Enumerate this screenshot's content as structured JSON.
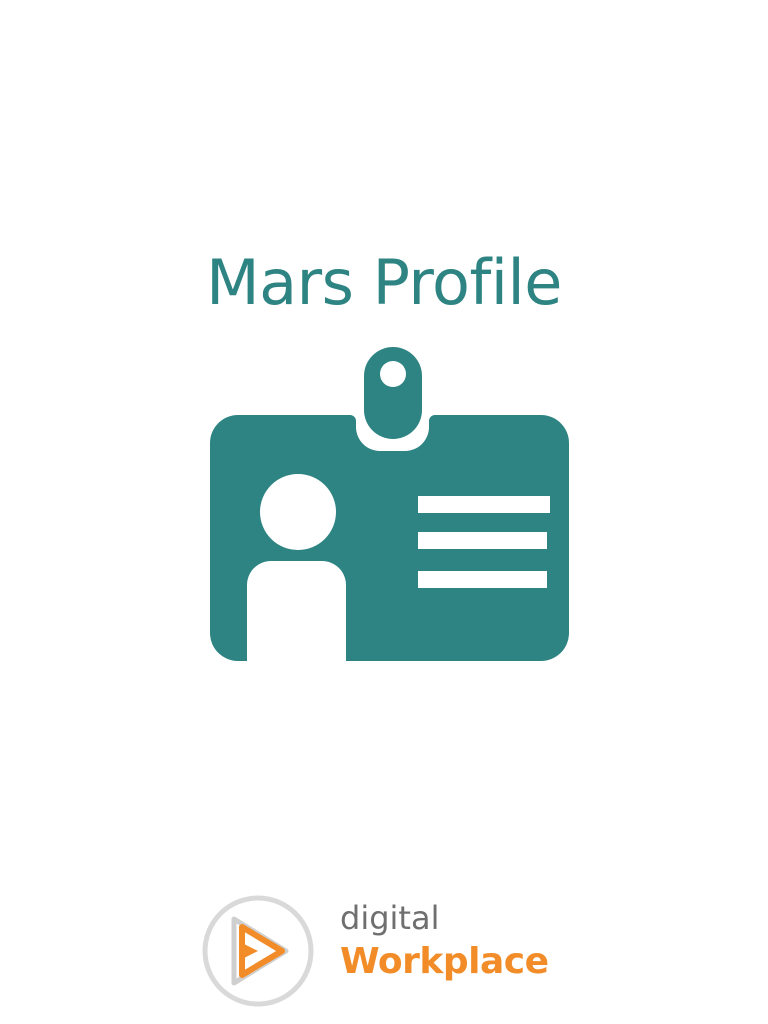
{
  "app": {
    "title": "Mars Profile"
  },
  "illustration": {
    "icon": "id-badge-icon",
    "color": "#2e8482"
  },
  "brand": {
    "line1": "digital",
    "line2": "Workplace",
    "logo_icon": "play-ring-logo",
    "accent_color": "#f28c28",
    "ring_color": "#d9d9d9"
  }
}
